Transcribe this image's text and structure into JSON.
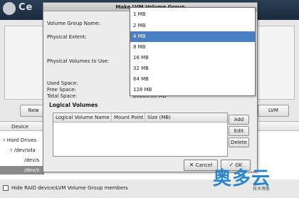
{
  "installer": {
    "logo_text": "Ce",
    "buttons": {
      "new_label": "New",
      "lvm_label": "LVM"
    },
    "tree": {
      "column_device": "Device",
      "items": [
        "Hard Drives",
        "/dev/sda",
        "/dev/s",
        "/dev/s"
      ]
    },
    "raid_checkbox_label": "Hide RAID device/LVM Volume Group members"
  },
  "dialog": {
    "title": "Make LVM Volume Group",
    "volume_group_name_label": "Volume Group Name:",
    "physical_extent_label": "Physical Extent:",
    "physical_volumes_label": "Physical Volumes to Use:",
    "used_space_label": "Used Space:",
    "free_space_label": "Free Space:",
    "total_space_label": "Total Space:",
    "total_space_value_partial": "20000.00 MB",
    "logical_volumes_title": "Logical Volumes",
    "table": {
      "columns": [
        "Logical Volume Name",
        "Mount Point",
        "Size (MB)"
      ]
    },
    "side_buttons": {
      "add": "Add",
      "edit": "Edit",
      "delete": "Delete"
    },
    "cancel_label": "Cancel",
    "ok_label": "OK"
  },
  "extent_dropdown": {
    "options": [
      "1 MB",
      "2 MB",
      "4 MB",
      "8 MB",
      "16 MB",
      "32 MB",
      "64 MB",
      "128 MB"
    ],
    "selected": "4 MB",
    "selected_color": "#4a7fc1"
  },
  "watermark": {
    "brand_cn": "奥多云",
    "sub": "技术博客"
  }
}
